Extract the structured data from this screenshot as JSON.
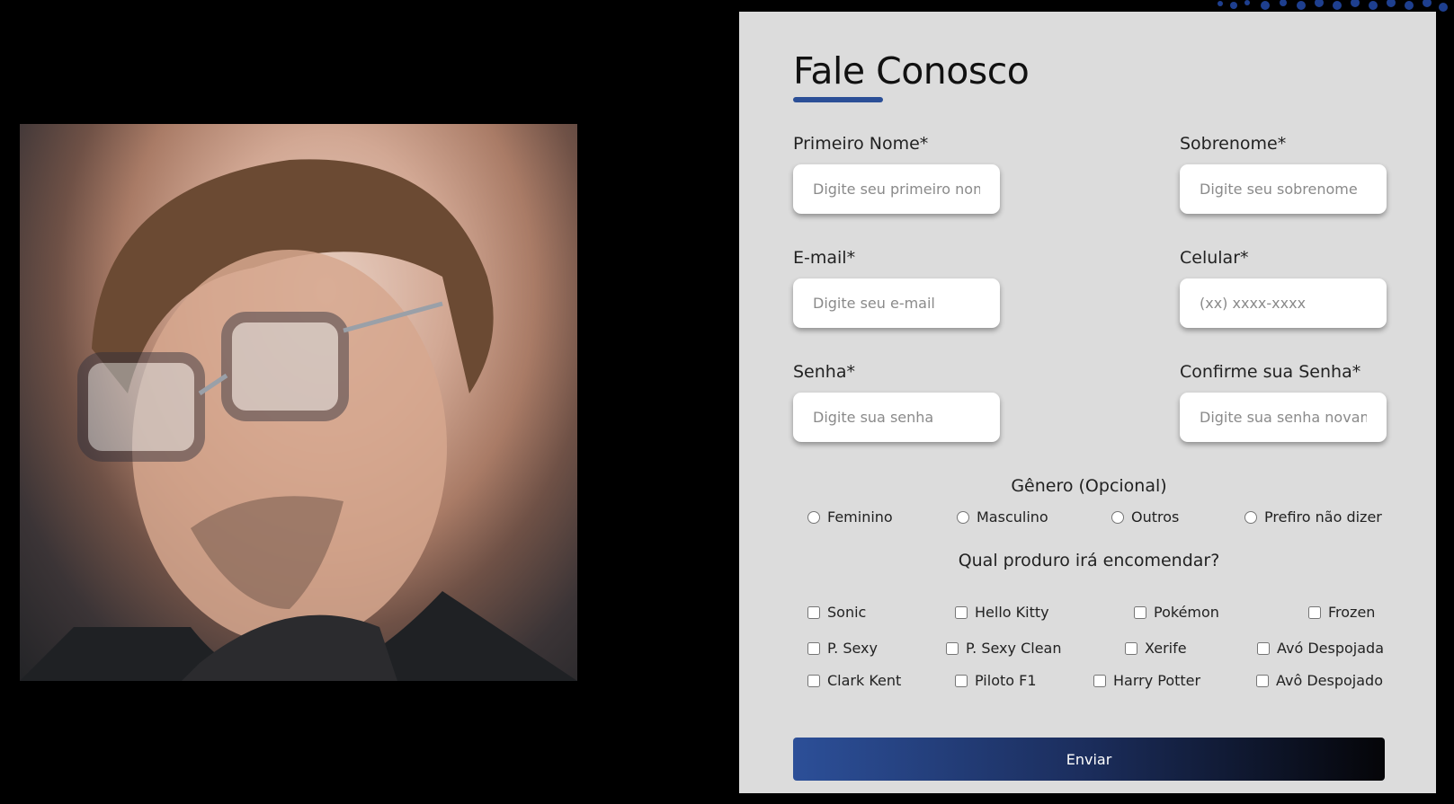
{
  "form": {
    "title": "Fale Conosco",
    "fields": {
      "first_name": {
        "label": "Primeiro Nome*",
        "placeholder": "Digite seu primeiro nome"
      },
      "last_name": {
        "label": "Sobrenome*",
        "placeholder": "Digite seu sobrenome"
      },
      "email": {
        "label": "E-mail*",
        "placeholder": "Digite seu e-mail"
      },
      "phone": {
        "label": "Celular*",
        "placeholder": "(xx) xxxx-xxxx"
      },
      "password": {
        "label": "Senha*",
        "placeholder": "Digite sua senha"
      },
      "password_confirm": {
        "label": "Confirme sua Senha*",
        "placeholder": "Digite sua senha novamente"
      }
    },
    "gender": {
      "title": "Gênero (Opcional)",
      "options": [
        "Feminino",
        "Masculino",
        "Outros",
        "Prefiro não dizer"
      ]
    },
    "products": {
      "title": "Qual produro irá encomendar?",
      "options": [
        "Sonic",
        "Hello Kitty",
        "Pokémon",
        "Frozen",
        "P. Sexy",
        "P. Sexy Clean",
        "Xerife",
        "Avó Despojada",
        "Clark Kent",
        "Piloto F1",
        "Harry Potter",
        "Avô Despojado"
      ]
    },
    "submit_label": "Enviar"
  },
  "colors": {
    "accent": "#2b4f97",
    "card_background": "#dcdcdc",
    "page_background": "#000000"
  }
}
